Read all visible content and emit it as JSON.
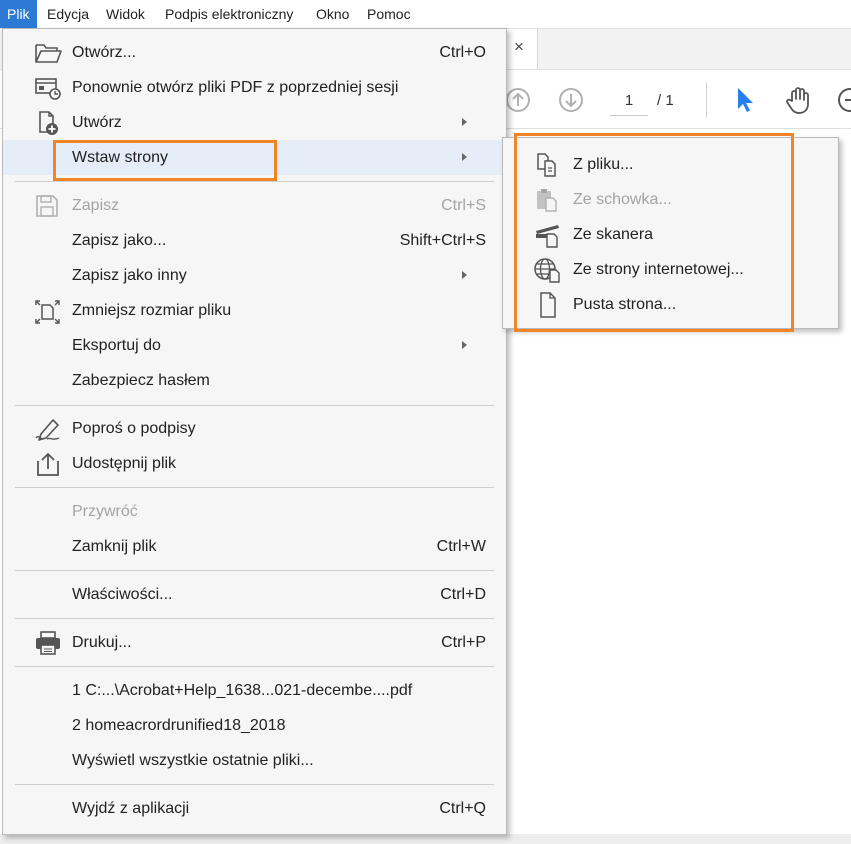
{
  "menubar": {
    "items": [
      {
        "label": "Plik"
      },
      {
        "label": "Edycja"
      },
      {
        "label": "Widok"
      },
      {
        "label": "Podpis elektroniczny"
      },
      {
        "label": "Okno"
      },
      {
        "label": "Pomoc"
      }
    ]
  },
  "toolbar": {
    "page_current": "1",
    "page_total": "/ 1",
    "tab_close": "×"
  },
  "file_menu": {
    "items": [
      {
        "label": "Otwórz...",
        "shortcut": "Ctrl+O",
        "icon": "folder-open-icon"
      },
      {
        "label": "Ponownie otwórz pliki PDF z poprzedniej sesji",
        "shortcut": "",
        "icon": "reopen-session-icon"
      },
      {
        "label": "Utwórz",
        "shortcut": "",
        "icon": "create-pdf-icon",
        "submenu": true
      },
      {
        "label": "Wstaw strony",
        "shortcut": "",
        "submenu": true,
        "highlighted": true
      },
      {
        "label": "Zapisz",
        "shortcut": "Ctrl+S",
        "icon": "save-icon",
        "disabled": true
      },
      {
        "label": "Zapisz jako...",
        "shortcut": "Shift+Ctrl+S"
      },
      {
        "label": "Zapisz jako inny",
        "shortcut": "",
        "submenu": true
      },
      {
        "label": "Zmniejsz rozmiar pliku",
        "shortcut": "",
        "icon": "reduce-size-icon"
      },
      {
        "label": "Eksportuj do",
        "shortcut": "",
        "submenu": true
      },
      {
        "label": "Zabezpiecz hasłem",
        "shortcut": ""
      },
      {
        "label": "Poproś o podpisy",
        "shortcut": "",
        "icon": "pen-sign-icon"
      },
      {
        "label": "Udostępnij plik",
        "shortcut": "",
        "icon": "share-icon"
      },
      {
        "label": "Przywróć",
        "shortcut": "",
        "disabled": true
      },
      {
        "label": "Zamknij plik",
        "shortcut": "Ctrl+W"
      },
      {
        "label": "Właściwości...",
        "shortcut": "Ctrl+D"
      },
      {
        "label": "Drukuj...",
        "shortcut": "Ctrl+P",
        "icon": "printer-icon"
      },
      {
        "label": "1 C:...\\Acrobat+Help_1638...021-decembe....pdf",
        "shortcut": ""
      },
      {
        "label": "2 homeacrordrunified18_2018",
        "shortcut": ""
      },
      {
        "label": "Wyświetl wszystkie ostatnie pliki...",
        "shortcut": ""
      },
      {
        "label": "Wyjdź z aplikacji",
        "shortcut": "Ctrl+Q"
      }
    ]
  },
  "insert_submenu": {
    "items": [
      {
        "label": "Z pliku...",
        "icon": "from-file-icon"
      },
      {
        "label": "Ze schowka...",
        "icon": "clipboard-icon",
        "disabled": true
      },
      {
        "label": "Ze skanera",
        "icon": "scanner-icon"
      },
      {
        "label": "Ze strony internetowej...",
        "icon": "web-page-icon"
      },
      {
        "label": "Pusta strona...",
        "icon": "blank-page-icon"
      }
    ]
  },
  "colors": {
    "menubar_active": "#2c7ad6",
    "highlight_row": "#e4edf8",
    "annotation_box": "#f08527",
    "toolbar_accent": "#2680eb"
  }
}
